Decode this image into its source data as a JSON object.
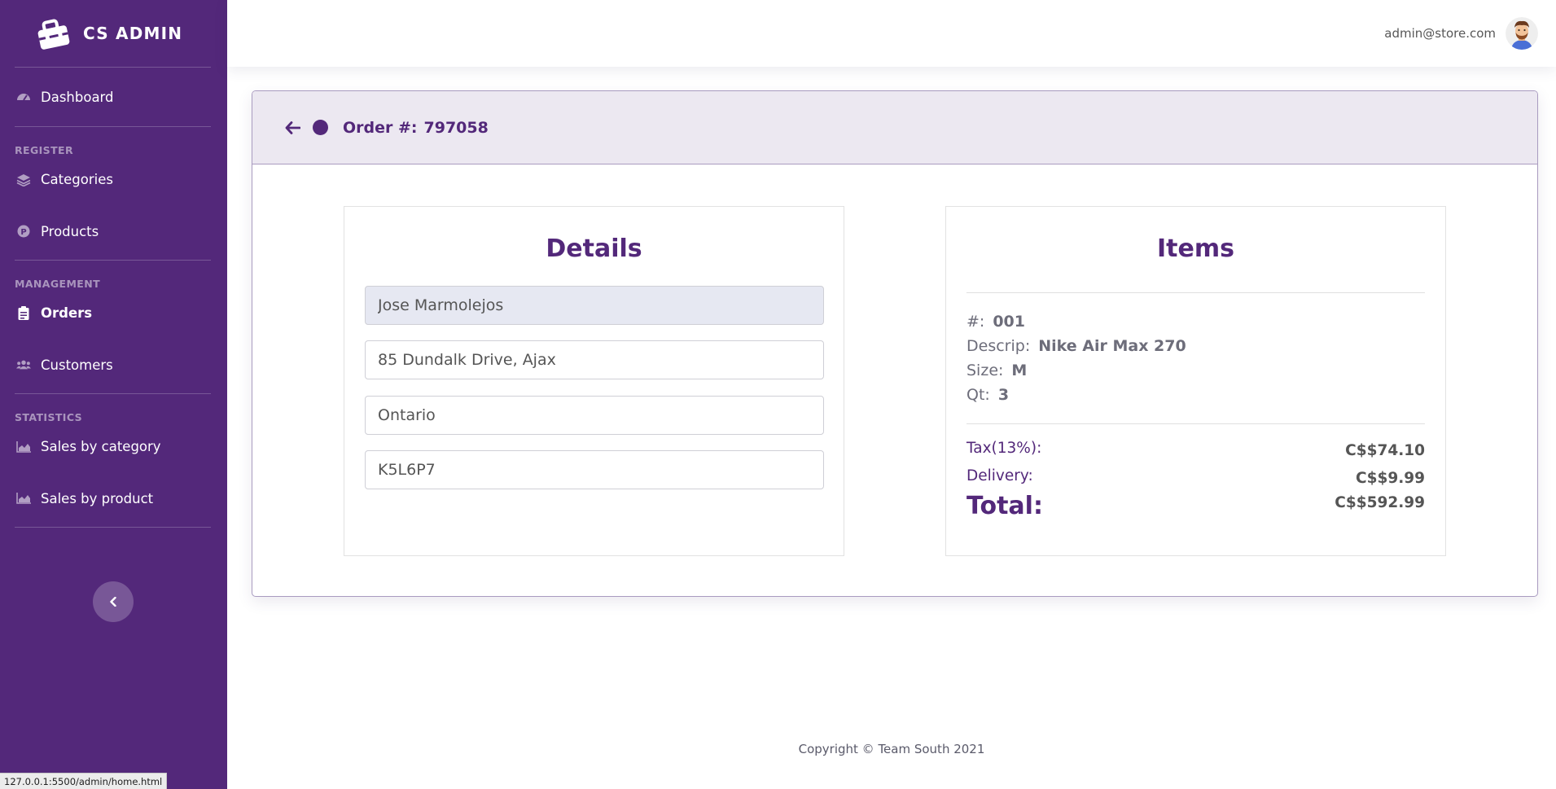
{
  "sidebar": {
    "brand": "CS ADMIN",
    "dashboard": "Dashboard",
    "register_heading": "REGISTER",
    "categories": "Categories",
    "products": "Products",
    "management_heading": "MANAGEMENT",
    "orders": "Orders",
    "customers": "Customers",
    "statistics_heading": "STATISTICS",
    "sales_by_category": "Sales by category",
    "sales_by_product": "Sales by product"
  },
  "topbar": {
    "user_email": "admin@store.com"
  },
  "order": {
    "label": "Order #:",
    "number": "797058"
  },
  "details": {
    "title": "Details",
    "name": "Jose Marmolejos",
    "address": "85 Dundalk Drive, Ajax",
    "province": "Ontario",
    "postal_code": "K5L6P7"
  },
  "items": {
    "title": "Items",
    "number_label": "#:",
    "number_value": "001",
    "descrip_label": "Descrip:",
    "descrip_value": "Nike Air Max 270",
    "size_label": "Size:",
    "size_value": "M",
    "qt_label": "Qt:",
    "qt_value": "3",
    "tax_label": "Tax(13%):",
    "tax_value": "C$$74.10",
    "delivery_label": "Delivery:",
    "delivery_value": "C$$9.99",
    "total_label": "Total:",
    "total_value": "C$$592.99"
  },
  "footer": {
    "copyright": "Copyright © Team South 2021"
  },
  "status_url": "127.0.0.1:5500/admin/home.html",
  "colors": {
    "primary": "#53287a",
    "header_bg": "#ece8f1",
    "filled_input": "#e6e8f2"
  }
}
